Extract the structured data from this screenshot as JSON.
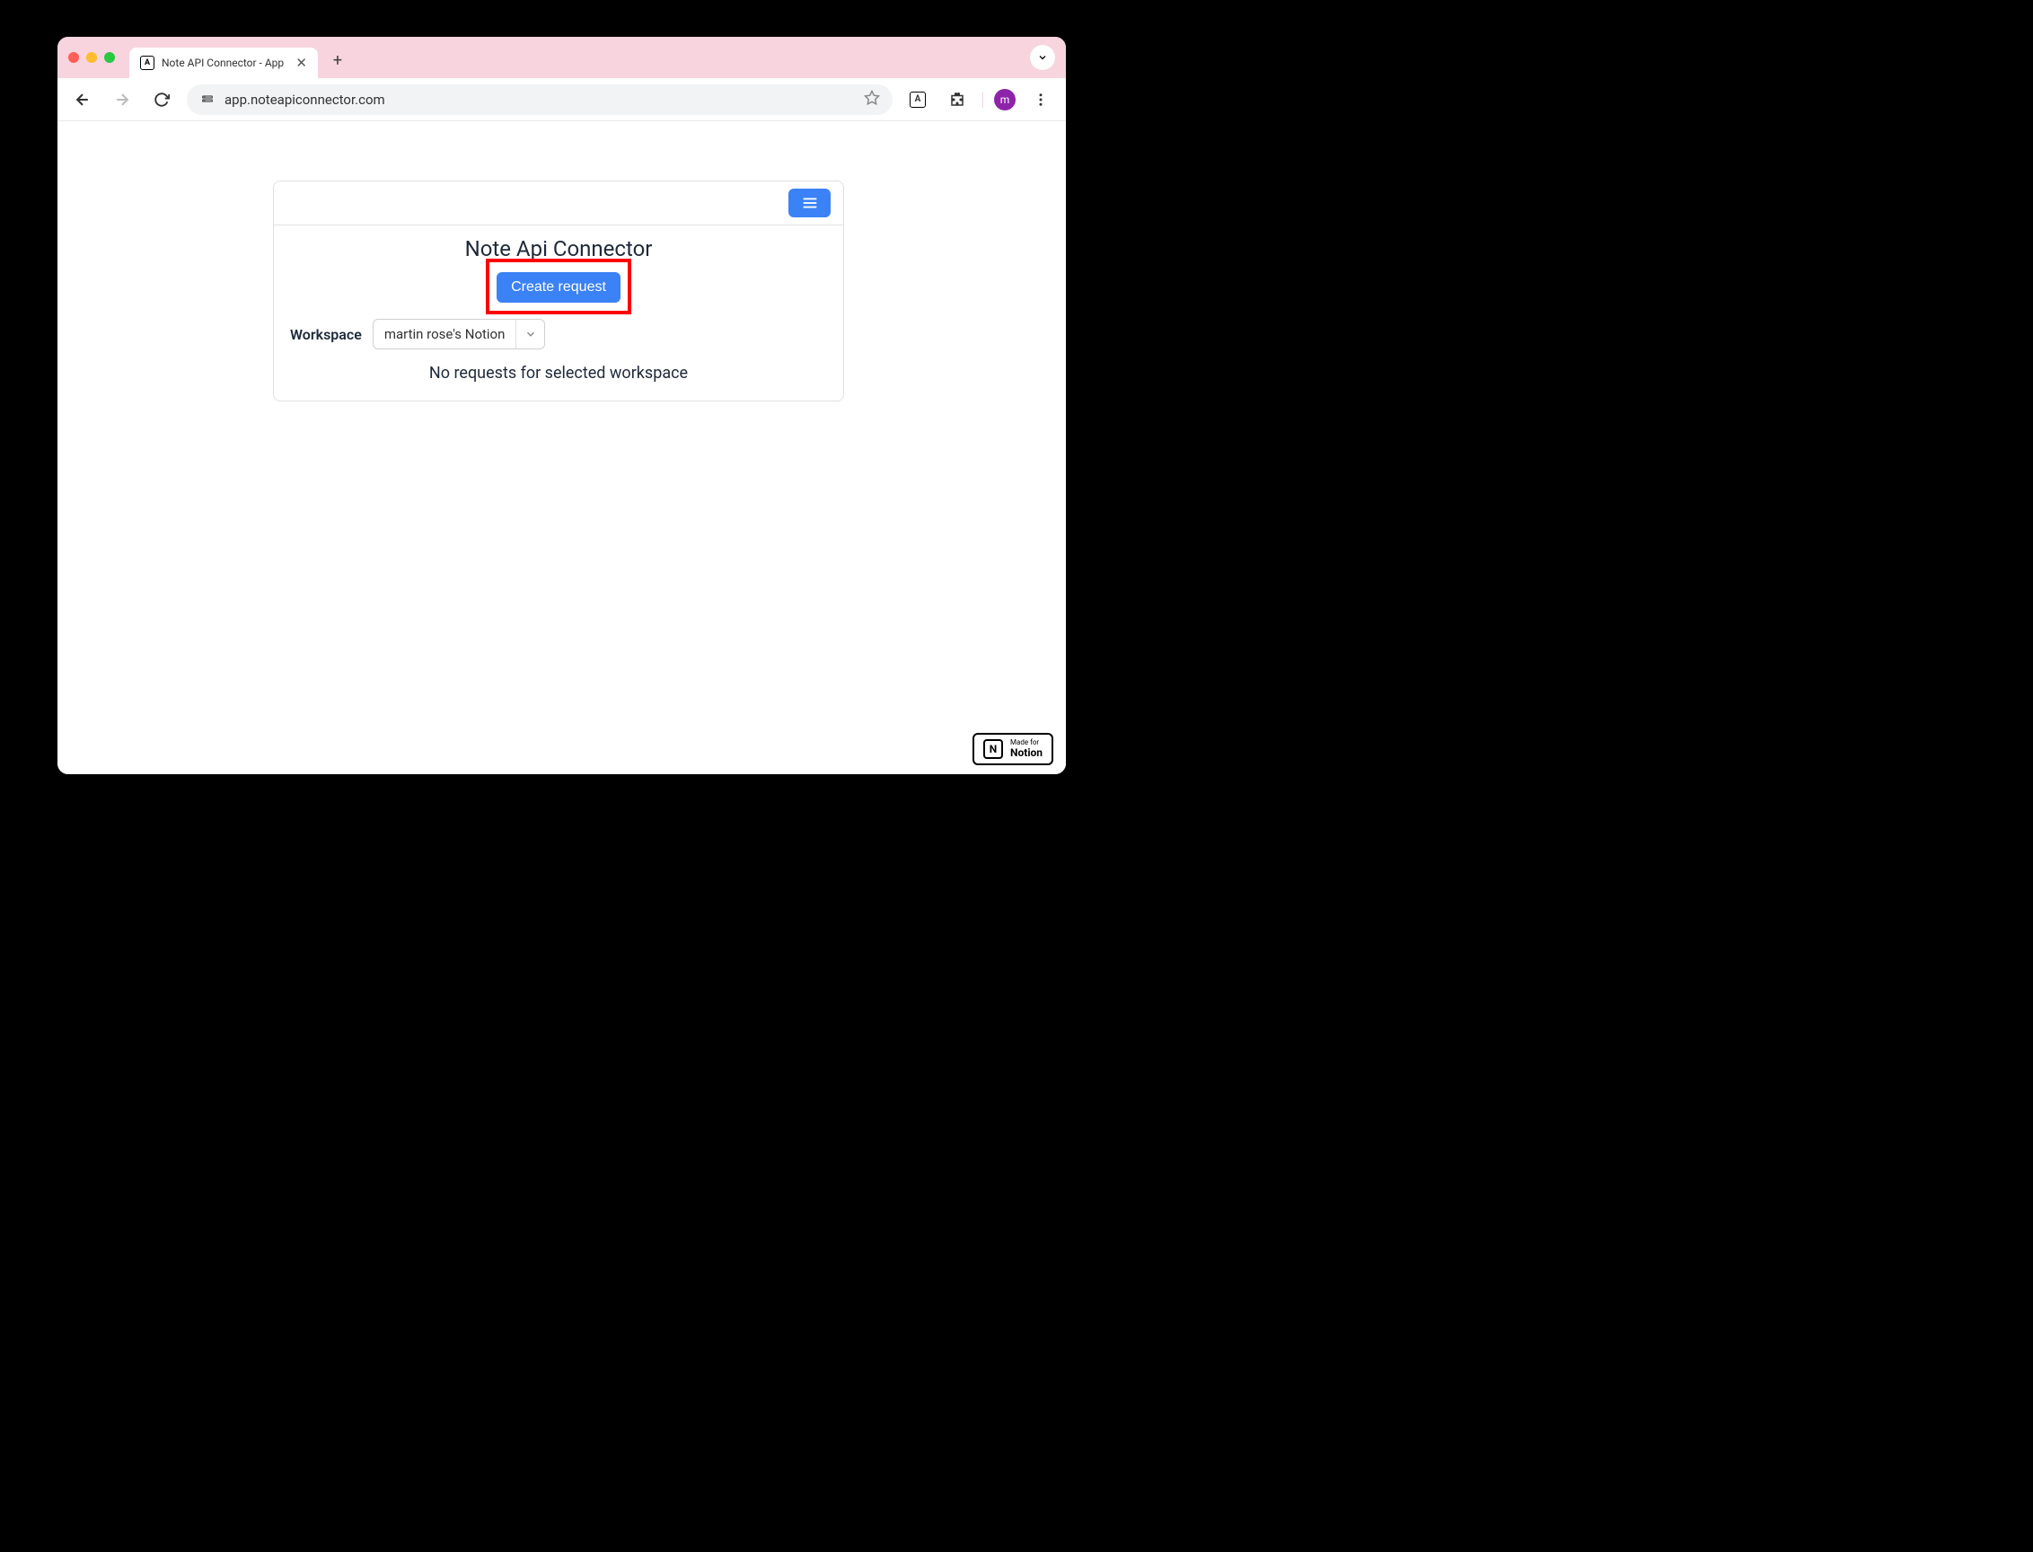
{
  "browser": {
    "tab": {
      "title": "Note API Connector - App",
      "favicon_letter": "A"
    },
    "url": "app.noteapiconnector.com",
    "profile_letter": "m"
  },
  "app": {
    "title": "Note Api Connector",
    "create_button_label": "Create request",
    "workspace": {
      "label": "Workspace",
      "selected": "martin rose's Notion"
    },
    "empty_message": "No requests for selected workspace"
  },
  "notion_badge": {
    "logo_letter": "N",
    "small_text": "Made for",
    "big_text": "Notion"
  }
}
